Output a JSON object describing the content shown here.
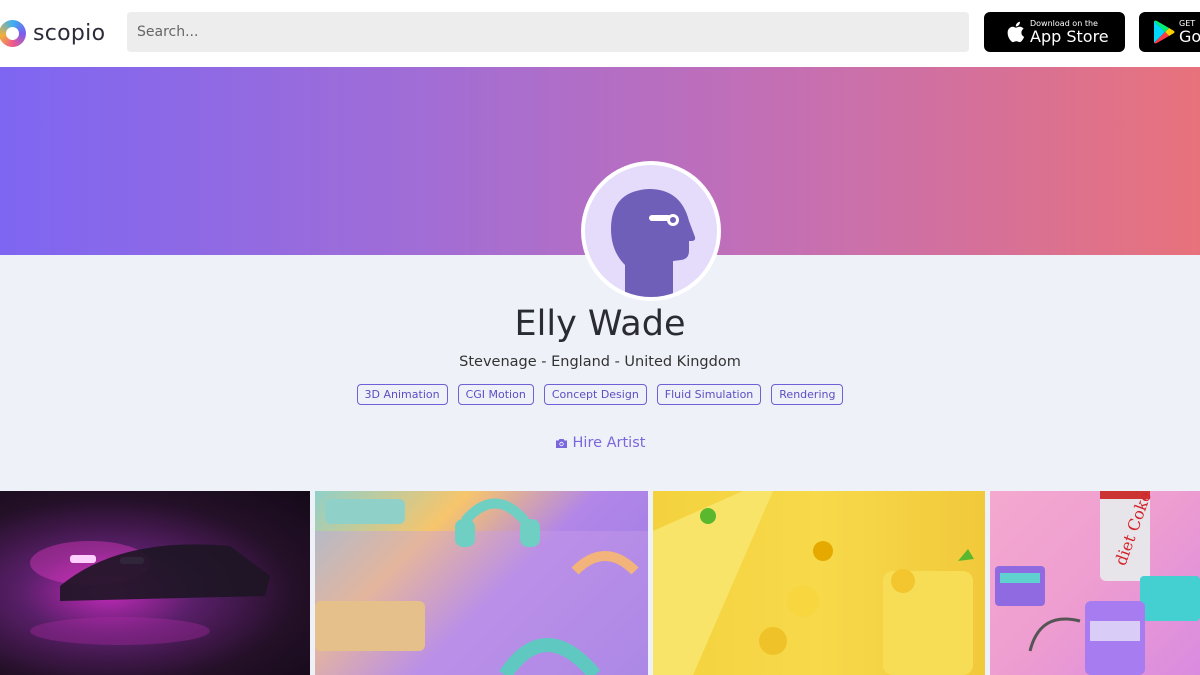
{
  "header": {
    "logo_text": "scopio",
    "search_placeholder": "Search...",
    "app_store": {
      "small": "Download on the",
      "big": "App Store"
    },
    "google_play": {
      "small": "GET",
      "big": "Go"
    }
  },
  "profile": {
    "name": "Elly Wade",
    "location": "Stevenage - England - United Kingdom",
    "tags": [
      "3D Animation",
      "CGI Motion",
      "Concept Design",
      "Fluid Simulation",
      "Rendering"
    ],
    "hire_label": "Hire Artist"
  },
  "colors": {
    "accent": "#7a66dd",
    "banner_start": "#7e66f2",
    "banner_end": "#e8727c",
    "avatar_bg": "#e5dbfb",
    "avatar_fg": "#6f5fb8"
  },
  "icons": {
    "apple": "apple-icon",
    "google_play": "google-play-icon",
    "camera": "camera-icon",
    "avatar": "person-silhouette-icon"
  }
}
